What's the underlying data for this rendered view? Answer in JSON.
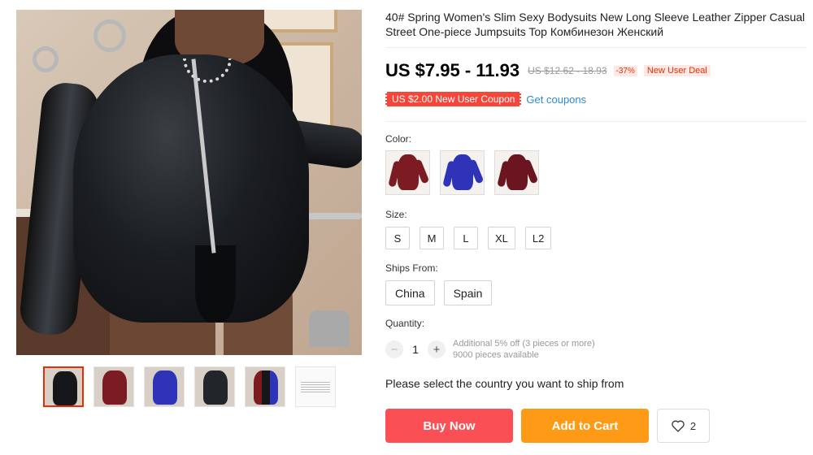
{
  "product": {
    "title": "40# Spring Women's Slim Sexy Bodysuits New Long Sleeve Leather Zipper Casual Street One-piece Jumpsuits Top Комбинезон Женский"
  },
  "price": {
    "current": "US $7.95 - 11.93",
    "original": "US $12.62 - 18.93",
    "discount": "-37%",
    "deal_badge": "New User Deal"
  },
  "coupon": {
    "label": "US $2.00 New User Coupon",
    "link": "Get coupons"
  },
  "color": {
    "label": "Color:",
    "options": [
      {
        "name": "wine-red",
        "color": "#7d1b22"
      },
      {
        "name": "blue",
        "color": "#2f33b8"
      },
      {
        "name": "dark-red",
        "color": "#6b1520"
      }
    ]
  },
  "size": {
    "label": "Size:",
    "options": [
      "S",
      "M",
      "L",
      "XL",
      "L2"
    ]
  },
  "ships_from": {
    "label": "Ships From:",
    "options": [
      "China",
      "Spain"
    ]
  },
  "quantity": {
    "label": "Quantity:",
    "minus": "−",
    "value": "1",
    "plus": "+",
    "additional": "Additional 5% off (3 pieces or more)",
    "available": "9000 pieces available"
  },
  "ship_message": "Please select the country you want to ship from",
  "actions": {
    "buy_now": "Buy Now",
    "add_to_cart": "Add to Cart",
    "wishlist_count": "2"
  },
  "gallery": {
    "thumbnails": [
      {
        "name": "black",
        "color": "#15171a"
      },
      {
        "name": "wine-red",
        "color": "#7d1b22"
      },
      {
        "name": "blue",
        "color": "#2f33b8"
      },
      {
        "name": "black-alt",
        "color": "#222529"
      },
      {
        "name": "multi",
        "color": "#3a2a5a"
      },
      {
        "name": "size-chart",
        "color": "#f4f4f4"
      }
    ]
  }
}
